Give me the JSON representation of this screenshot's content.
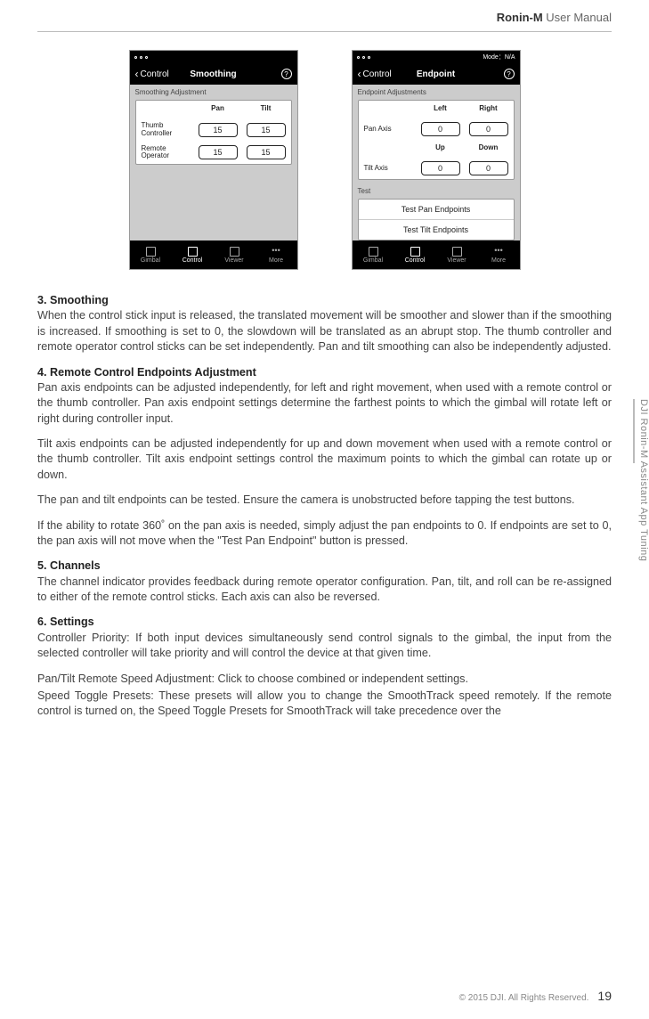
{
  "header": {
    "brand": "Ronin-M",
    "doc": "User Manual"
  },
  "sideTab": "DJI Ronin-M Assistant App Tuning",
  "footer": {
    "copyright": "© 2015 DJI. All Rights Reserved.",
    "page": "19"
  },
  "screenA": {
    "back": "Control",
    "title": "Smoothing",
    "subheader": "Smoothing Adjustment",
    "colA": "Pan",
    "colB": "Tilt",
    "row1Label": "Thumb Controller",
    "row1A": "15",
    "row1B": "15",
    "row2Label": "Remote Operator",
    "row2A": "15",
    "row2B": "15",
    "nav": {
      "gimbal": "Gimbal",
      "control": "Control",
      "viewer": "Viewer",
      "more": "More"
    }
  },
  "screenB": {
    "mode": "Mode：N/A",
    "back": "Control",
    "title": "Endpoint",
    "subheader": "Endpoint Adjustments",
    "panLabel": "Pan Axis",
    "panColA": "Left",
    "panColB": "Right",
    "panA": "0",
    "panB": "0",
    "tiltLabel": "Tilt Axis",
    "tiltColA": "Up",
    "tiltColB": "Down",
    "tiltA": "0",
    "tiltB": "0",
    "testHeader": "Test",
    "testPan": "Test Pan Endpoints",
    "testTilt": "Test Tilt Endpoints",
    "nav": {
      "gimbal": "Gimbal",
      "control": "Control",
      "viewer": "Viewer",
      "more": "More"
    }
  },
  "text": {
    "s3_title": "3. Smoothing",
    "s3_body": "When the control stick input is released, the translated movement will be smoother and slower than if the smoothing is increased. If smoothing is set to 0, the slowdown will be translated as an abrupt stop. The thumb controller and remote operator control sticks can be set independently. Pan and tilt smoothing can also be independently adjusted.",
    "s4_title": "4. Remote Control Endpoints Adjustment",
    "s4_p1": "Pan axis endpoints can be adjusted independently, for left and right movement, when used with a remote control or the thumb controller. Pan axis endpoint settings determine the farthest points to which the gimbal will rotate left or right during controller input.",
    "s4_p2": "Tilt axis endpoints can be adjusted independently for up and down movement when used with a remote control or the thumb controller. Tilt axis endpoint settings control the maximum points to which the gimbal can rotate up or down.",
    "s4_p3": "The pan and tilt endpoints can be tested. Ensure the camera is unobstructed before tapping the test buttons.",
    "s4_p4": "If the ability to rotate 360˚ on the pan axis is needed, simply adjust the pan endpoints to 0. If endpoints are set to 0, the pan axis will not move when the \"Test Pan Endpoint\" button is pressed.",
    "s5_title": "5. Channels",
    "s5_body": "The channel indicator provides feedback during remote operator configuration. Pan, tilt, and roll can be re-assigned to either of the remote control sticks. Each axis can also be reversed.",
    "s6_title": "6. Settings",
    "s6_p1": "Controller Priority: If both input devices simultaneously send control signals to the gimbal, the input from the selected controller will take priority and will control the device at that given time.",
    "s6_p2": "Pan/Tilt Remote Speed Adjustment: Click to choose combined or independent settings.",
    "s6_p3": "Speed Toggle Presets: These presets will allow you to change the SmoothTrack speed remotely. If the remote control is turned on, the Speed Toggle Presets for SmoothTrack will take precedence over the"
  }
}
